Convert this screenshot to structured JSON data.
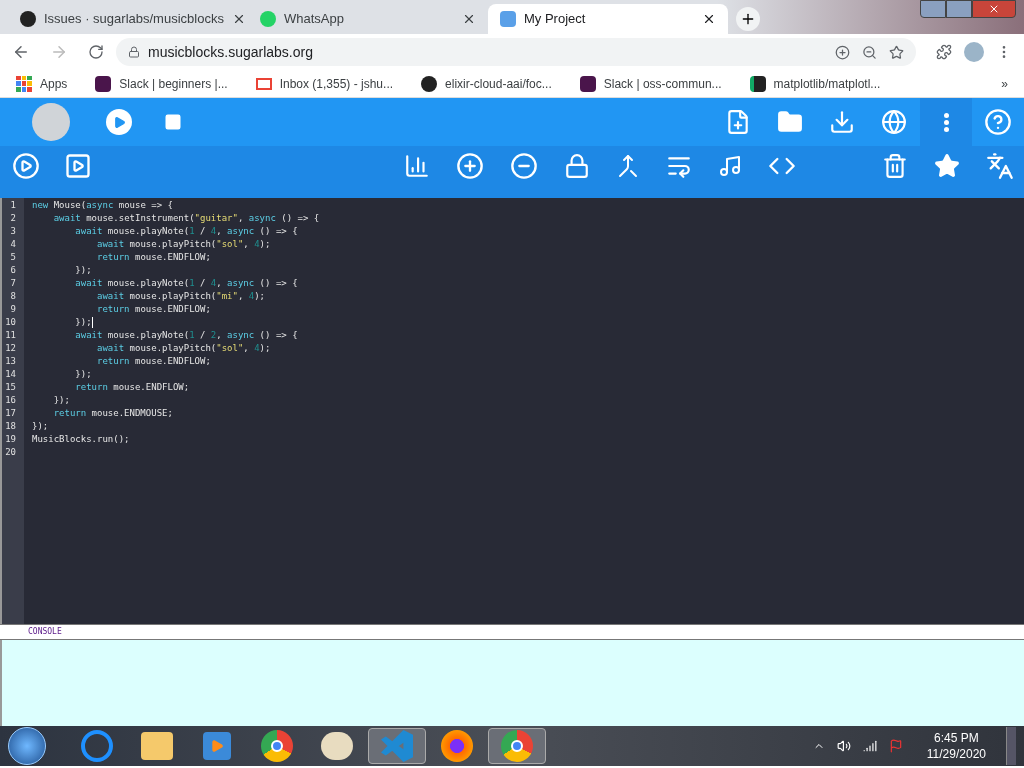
{
  "browser": {
    "tabs": [
      {
        "title": "Issues · sugarlabs/musicblocks",
        "selected": false
      },
      {
        "title": "WhatsApp",
        "selected": false
      },
      {
        "title": "My Project",
        "selected": true
      }
    ],
    "address": "musicblocks.sugarlabs.org",
    "bookmarks": [
      {
        "label": "Apps"
      },
      {
        "label": "Slack | beginners |..."
      },
      {
        "label": "Inbox (1,355) - jshu..."
      },
      {
        "label": "elixir-cloud-aai/foc..."
      },
      {
        "label": "Slack | oss-commun..."
      },
      {
        "label": "matplotlib/matplotl..."
      }
    ],
    "bookmarks_more": "»"
  },
  "editor": {
    "lines": [
      {
        "number": "1",
        "tokens": [
          {
            "kind": "kw",
            "text": "new"
          },
          {
            "kind": "plain",
            "text": " Mouse("
          },
          {
            "kind": "kw",
            "text": "async"
          },
          {
            "kind": "plain",
            "text": " mouse => {"
          }
        ]
      },
      {
        "number": "2",
        "tokens": [
          {
            "kind": "kw",
            "text": "    await"
          },
          {
            "kind": "plain",
            "text": " mouse.setInstrument("
          },
          {
            "kind": "str",
            "text": "\"guitar\""
          },
          {
            "kind": "plain",
            "text": ", "
          },
          {
            "kind": "kw",
            "text": "async"
          },
          {
            "kind": "plain",
            "text": " () => {"
          }
        ]
      },
      {
        "number": "3",
        "tokens": [
          {
            "kind": "kw",
            "text": "        await"
          },
          {
            "kind": "plain",
            "text": " mouse.playNote("
          },
          {
            "kind": "num",
            "text": "1"
          },
          {
            "kind": "plain",
            "text": " / "
          },
          {
            "kind": "num",
            "text": "4"
          },
          {
            "kind": "plain",
            "text": ", "
          },
          {
            "kind": "kw",
            "text": "async"
          },
          {
            "kind": "plain",
            "text": " () => {"
          }
        ]
      },
      {
        "number": "4",
        "tokens": [
          {
            "kind": "kw",
            "text": "            await"
          },
          {
            "kind": "plain",
            "text": " mouse.playPitch("
          },
          {
            "kind": "str",
            "text": "\"sol\""
          },
          {
            "kind": "plain",
            "text": ", "
          },
          {
            "kind": "num",
            "text": "4"
          },
          {
            "kind": "plain",
            "text": ");"
          }
        ]
      },
      {
        "number": "5",
        "tokens": [
          {
            "kind": "kw",
            "text": "            return"
          },
          {
            "kind": "plain",
            "text": " mouse.ENDFLOW;"
          }
        ]
      },
      {
        "number": "6",
        "tokens": [
          {
            "kind": "plain",
            "text": "        });"
          }
        ]
      },
      {
        "number": "7",
        "tokens": [
          {
            "kind": "kw",
            "text": "        await"
          },
          {
            "kind": "plain",
            "text": " mouse.playNote("
          },
          {
            "kind": "num",
            "text": "1"
          },
          {
            "kind": "plain",
            "text": " / "
          },
          {
            "kind": "num",
            "text": "4"
          },
          {
            "kind": "plain",
            "text": ", "
          },
          {
            "kind": "kw",
            "text": "async"
          },
          {
            "kind": "plain",
            "text": " () => {"
          }
        ]
      },
      {
        "number": "8",
        "tokens": [
          {
            "kind": "kw",
            "text": "            await"
          },
          {
            "kind": "plain",
            "text": " mouse.playPitch("
          },
          {
            "kind": "str",
            "text": "\"mi\""
          },
          {
            "kind": "plain",
            "text": ", "
          },
          {
            "kind": "num",
            "text": "4"
          },
          {
            "kind": "plain",
            "text": ");"
          }
        ]
      },
      {
        "number": "9",
        "tokens": [
          {
            "kind": "kw",
            "text": "            return"
          },
          {
            "kind": "plain",
            "text": " mouse.ENDFLOW;"
          }
        ]
      },
      {
        "number": "10",
        "cursor": true,
        "tokens": [
          {
            "kind": "plain",
            "text": "        });"
          }
        ]
      },
      {
        "number": "11",
        "tokens": [
          {
            "kind": "kw",
            "text": "        await"
          },
          {
            "kind": "plain",
            "text": " mouse.playNote("
          },
          {
            "kind": "num",
            "text": "1"
          },
          {
            "kind": "plain",
            "text": " / "
          },
          {
            "kind": "num",
            "text": "2"
          },
          {
            "kind": "plain",
            "text": ", "
          },
          {
            "kind": "kw",
            "text": "async"
          },
          {
            "kind": "plain",
            "text": " () => {"
          }
        ]
      },
      {
        "number": "12",
        "tokens": [
          {
            "kind": "kw",
            "text": "            await"
          },
          {
            "kind": "plain",
            "text": " mouse.playPitch("
          },
          {
            "kind": "str",
            "text": "\"sol\""
          },
          {
            "kind": "plain",
            "text": ", "
          },
          {
            "kind": "num",
            "text": "4"
          },
          {
            "kind": "plain",
            "text": ");"
          }
        ]
      },
      {
        "number": "13",
        "tokens": [
          {
            "kind": "kw",
            "text": "            return"
          },
          {
            "kind": "plain",
            "text": " mouse.ENDFLOW;"
          }
        ]
      },
      {
        "number": "14",
        "tokens": [
          {
            "kind": "plain",
            "text": "        });"
          }
        ]
      },
      {
        "number": "15",
        "tokens": [
          {
            "kind": "kw",
            "text": "        return"
          },
          {
            "kind": "plain",
            "text": " mouse.ENDFLOW;"
          }
        ]
      },
      {
        "number": "16",
        "tokens": [
          {
            "kind": "plain",
            "text": "    });"
          }
        ]
      },
      {
        "number": "17",
        "tokens": [
          {
            "kind": "kw",
            "text": "    return"
          },
          {
            "kind": "plain",
            "text": " mouse.ENDMOUSE;"
          }
        ]
      },
      {
        "number": "18",
        "tokens": [
          {
            "kind": "plain",
            "text": "});"
          }
        ]
      },
      {
        "number": "19",
        "tokens": [
          {
            "kind": "plain",
            "text": "MusicBlocks.run();"
          }
        ]
      },
      {
        "number": "20"
      }
    ]
  },
  "console": {
    "title": "CONSOLE"
  },
  "taskbar": {
    "apps": [
      {
        "selected": false
      },
      {
        "selected": false
      },
      {
        "selected": false
      },
      {
        "selected": false
      },
      {
        "selected": false
      },
      {
        "selected": true
      },
      {
        "selected": false
      },
      {
        "selected": true
      }
    ],
    "time": "6:45 PM",
    "date": "11/29/2020"
  }
}
